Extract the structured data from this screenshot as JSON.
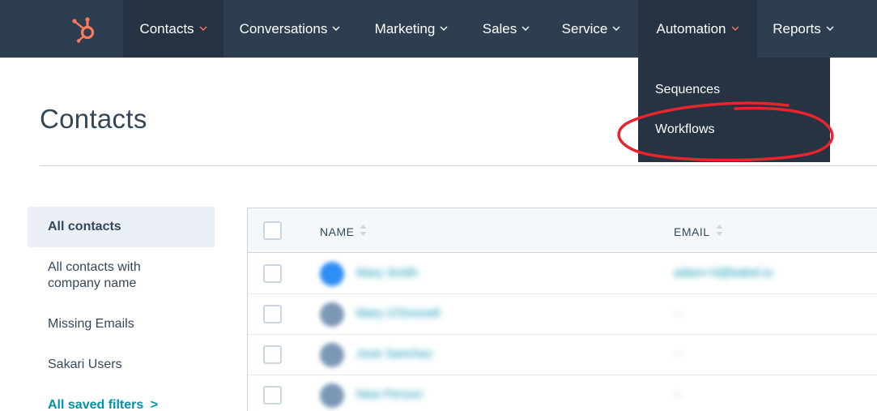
{
  "nav": {
    "logo_icon": "hubspot-sprocket-icon",
    "items": [
      {
        "label": "Contacts",
        "chevron_color": "#ff7a59"
      },
      {
        "label": "Conversations",
        "chevron_color": "#ffffff"
      },
      {
        "label": "Marketing",
        "chevron_color": "#ffffff"
      },
      {
        "label": "Sales",
        "chevron_color": "#ffffff"
      },
      {
        "label": "Service",
        "chevron_color": "#ffffff"
      },
      {
        "label": "Automation",
        "chevron_color": "#ff7a59"
      },
      {
        "label": "Reports",
        "chevron_color": "#ffffff"
      }
    ]
  },
  "dropdown": {
    "items": [
      "Sequences",
      "Workflows"
    ],
    "highlighted": "Workflows",
    "annotation_color": "#e8242c"
  },
  "page": {
    "title": "Contacts"
  },
  "sidebar": {
    "items": [
      {
        "label": "All contacts",
        "active": true
      },
      {
        "label": "All contacts with company name",
        "active": false
      },
      {
        "label": "Missing Emails",
        "active": false
      },
      {
        "label": "Sakari Users",
        "active": false
      }
    ],
    "saved_filters_link": "All saved filters",
    "saved_filters_chevron": ">"
  },
  "table": {
    "columns": [
      "NAME",
      "EMAIL"
    ],
    "rows": [
      {
        "name": "Mary Smith",
        "email": "adam+4@babel.io"
      },
      {
        "name": "Mary O'Donnell",
        "email": "--"
      },
      {
        "name": "Jose Sanchez",
        "email": "--"
      },
      {
        "name": "New Person",
        "email": "--"
      }
    ]
  },
  "colors": {
    "nav_bg": "#2d3e50",
    "nav_active_bg": "#253342",
    "brand_orange": "#ff7a59",
    "link": "#0091ae",
    "text": "#33475b"
  }
}
